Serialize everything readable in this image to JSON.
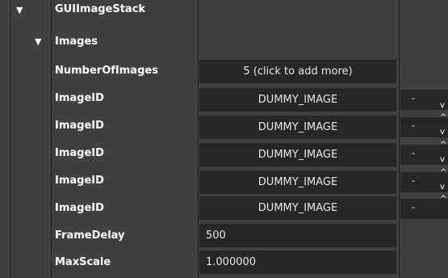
{
  "tree": {
    "toggle_glyph": "▼",
    "root_label": "GUIImageStack",
    "images_label": "Images",
    "number_of_images_label": "NumberOfImages",
    "number_of_images_value": "5 (click to add more)",
    "image_id_label": "ImageID",
    "image_ids": [
      "DUMMY_IMAGE",
      "DUMMY_IMAGE",
      "DUMMY_IMAGE",
      "DUMMY_IMAGE",
      "DUMMY_IMAGE"
    ],
    "frame_delay_label": "FrameDelay",
    "frame_delay_value": "500",
    "max_scale_label": "MaxScale",
    "max_scale_value": "1.000000"
  },
  "stepper": {
    "minus_glyph": "-",
    "up_glyph": "^",
    "down_glyph": "v"
  },
  "colors": {
    "panel_bg": "#404040",
    "field_bg": "#262626",
    "divider": "#1e1e1e",
    "text": "#ffffff"
  }
}
